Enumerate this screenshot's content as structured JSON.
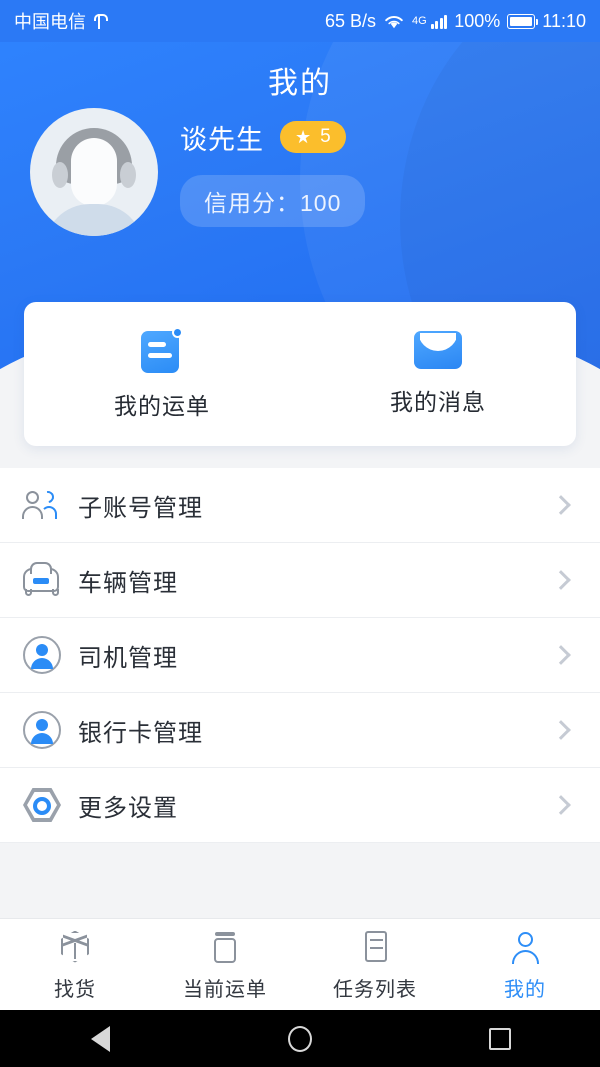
{
  "status_bar": {
    "carrier": "中国电信",
    "usb_icon": "usb-icon",
    "network_speed": "65 B/s",
    "wifi_icon": "wifi-icon",
    "network_type": "4G",
    "battery_percent": "100%",
    "time": "11:10"
  },
  "header": {
    "title": "我的",
    "avatar_icon": "avatar-placeholder-icon",
    "user_name": "谈先生",
    "star_icon": "star-icon",
    "star_level": "5",
    "credit_label": "信用分：100",
    "background_color": "#2b79f5",
    "badge_color": "#fbbe2c"
  },
  "shortcut_card": {
    "items": [
      {
        "label": "我的运单",
        "icon": "waybill-document-icon",
        "has_badge": true
      },
      {
        "label": "我的消息",
        "icon": "mail-envelope-icon",
        "has_badge": false
      }
    ]
  },
  "menu": {
    "items": [
      {
        "label": "子账号管理",
        "icon": "users-icon"
      },
      {
        "label": "车辆管理",
        "icon": "car-icon"
      },
      {
        "label": "司机管理",
        "icon": "driver-person-icon"
      },
      {
        "label": "银行卡管理",
        "icon": "bank-card-person-icon"
      },
      {
        "label": "更多设置",
        "icon": "settings-hexagon-icon"
      }
    ],
    "chevron_icon": "chevron-right-icon"
  },
  "tab_bar": {
    "active_color": "#2e8ef7",
    "inactive_color": "#333840",
    "tabs": [
      {
        "label": "找货",
        "icon": "cube-icon",
        "active": false
      },
      {
        "label": "当前运单",
        "icon": "container-icon",
        "active": false
      },
      {
        "label": "任务列表",
        "icon": "task-list-icon",
        "active": false
      },
      {
        "label": "我的",
        "icon": "person-icon",
        "active": true
      }
    ]
  },
  "android_nav": {
    "back_icon": "back-triangle-icon",
    "home_icon": "home-circle-icon",
    "recents_icon": "recents-square-icon"
  }
}
